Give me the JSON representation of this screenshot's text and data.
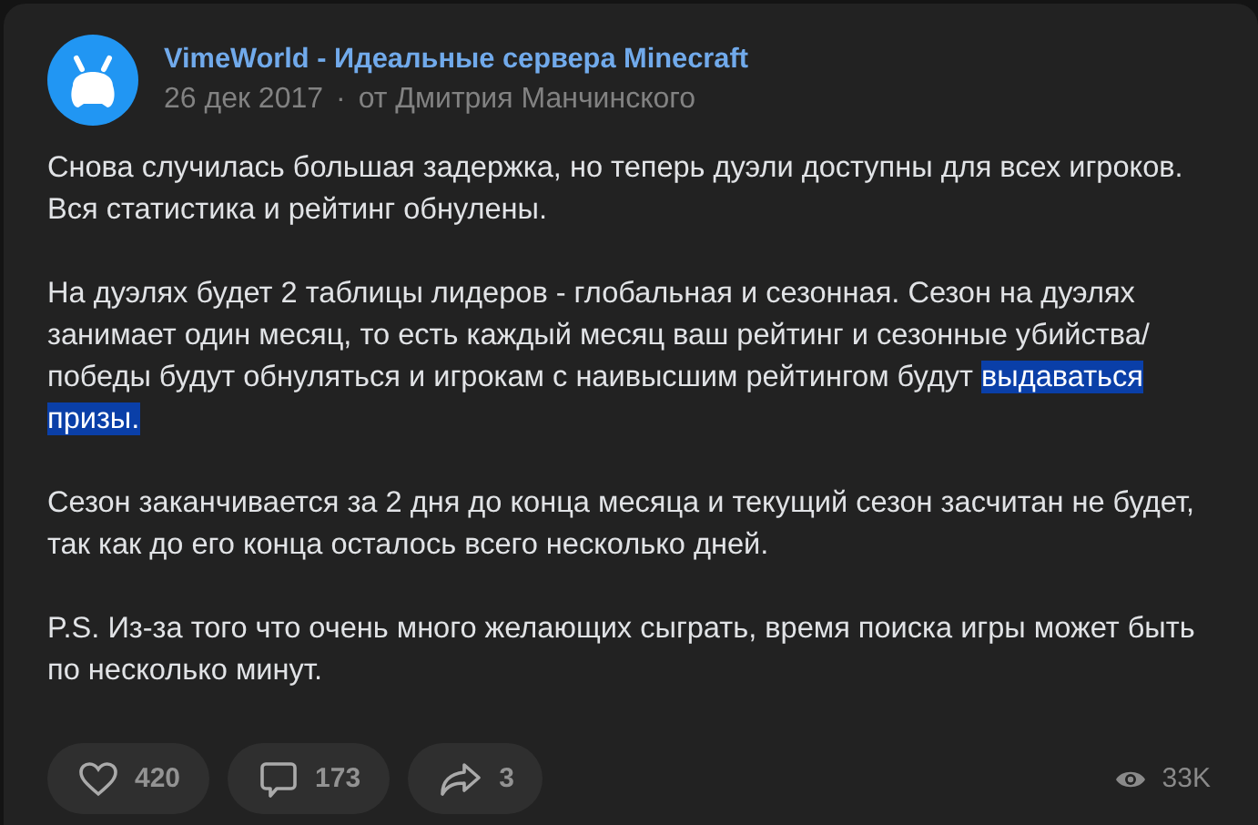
{
  "post": {
    "author": "VimeWorld - Идеальные сервера Minecraft",
    "date": "26 дек 2017",
    "separator": "·",
    "signed_by": "от Дмитрия Манчинского",
    "paragraphs": [
      [
        {
          "text": "Снова случилась большая задержка, но теперь дуэли доступны для всех игроков. Вся статистика и рейтинг обнулены.",
          "highlighted": false
        }
      ],
      [
        {
          "text": "На дуэлях будет 2 таблицы лидеров - глобальная и сезонная. Сезон на дуэлях занимает один месяц, то есть каждый месяц ваш рейтинг и сезонные убийства/победы будут обнуляться и игрокам с наивысшим рейтингом будут ",
          "highlighted": false
        },
        {
          "text": "выдаваться призы.",
          "highlighted": true
        }
      ],
      [
        {
          "text": "Сезон заканчивается за 2 дня до конца месяца и текущий сезон засчитан не будет, так как до его конца осталось всего несколько дней.",
          "highlighted": false
        }
      ],
      [
        {
          "text": "P.S. Из-за того что очень много желающих сыграть, время поиска игры может быть по несколько минут.",
          "highlighted": false
        }
      ]
    ],
    "actions": [
      {
        "kind": "like",
        "count": "420"
      },
      {
        "kind": "comment",
        "count": "173"
      },
      {
        "kind": "share",
        "count": "3"
      }
    ],
    "views": "33K"
  }
}
